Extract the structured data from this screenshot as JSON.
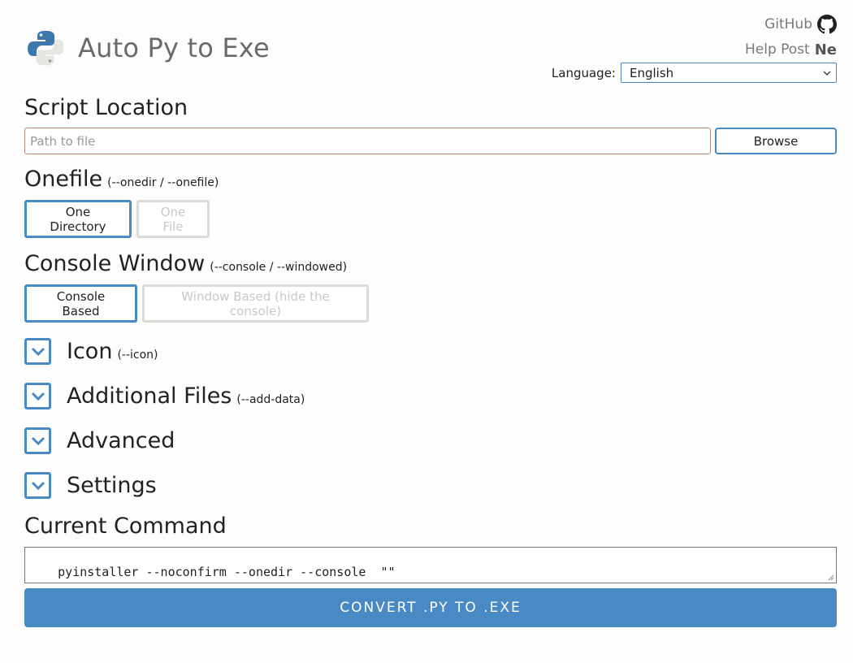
{
  "header": {
    "app_title": "Auto Py to Exe",
    "links": {
      "github": "GitHub",
      "help_post": "Help Post",
      "ne_mark": "Ne"
    },
    "language": {
      "label": "Language:",
      "selected": "English"
    }
  },
  "script_location": {
    "title": "Script Location",
    "placeholder": "Path to file",
    "browse_label": "Browse"
  },
  "onefile": {
    "title": "Onefile",
    "flag": "(--onedir / --onefile)",
    "options": [
      "One Directory",
      "One File"
    ],
    "selected": "One Directory"
  },
  "console_window": {
    "title": "Console Window",
    "flag": "(--console / --windowed)",
    "options": [
      "Console Based",
      "Window Based (hide the console)"
    ],
    "selected": "Console Based"
  },
  "sections": [
    {
      "title": "Icon",
      "flag": "(--icon)"
    },
    {
      "title": "Additional Files",
      "flag": "(--add-data)"
    },
    {
      "title": "Advanced",
      "flag": ""
    },
    {
      "title": "Settings",
      "flag": ""
    }
  ],
  "current_command": {
    "title": "Current Command",
    "value": "pyinstaller --noconfirm --onedir --console  \"\""
  },
  "convert_label": "CONVERT .PY TO .EXE",
  "colors": {
    "accent": "#4a8ac4",
    "inactive_border": "#dcdcd6",
    "title_gray": "#6a6a6a"
  },
  "icons": [
    "python-logo-icon",
    "github-icon",
    "chevron-down-icon"
  ]
}
